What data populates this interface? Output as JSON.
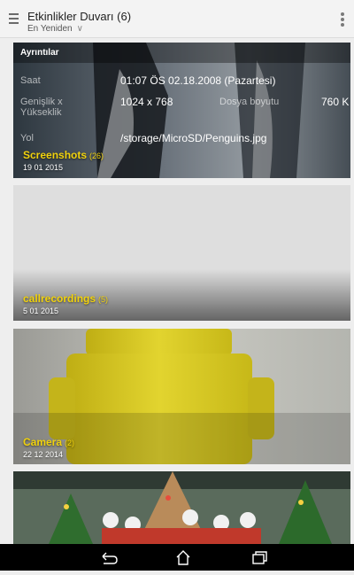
{
  "header": {
    "title": "Etkinlikler Duvarı (6)",
    "sort_label": "En Yeniden",
    "sort_chevron": "∨"
  },
  "details_panel": {
    "heading": "Ayrıntılar",
    "rows": {
      "time_label": "Saat",
      "time_value": "01:07 ÖS 02.18.2008 (Pazartesi)",
      "size_label_1": "Genişlik x",
      "size_label_2": "Yükseklik",
      "size_value": "1024 x 768",
      "file_size_label": "Dosya boyutu",
      "file_size_value": "760 K",
      "path_label": "Yol",
      "path_value": "/storage/MicroSD/Penguins.jpg"
    }
  },
  "albums": [
    {
      "name": "Screenshots",
      "count": "(26)",
      "date": "19 01 2015"
    },
    {
      "name": "callrecordings",
      "count": "(5)",
      "date": "5 01 2015"
    },
    {
      "name": "Camera",
      "count": "(2)",
      "date": "22 12 2014"
    }
  ],
  "navigation": {
    "icons": [
      "back-icon",
      "home-icon",
      "recent-apps-icon"
    ]
  }
}
